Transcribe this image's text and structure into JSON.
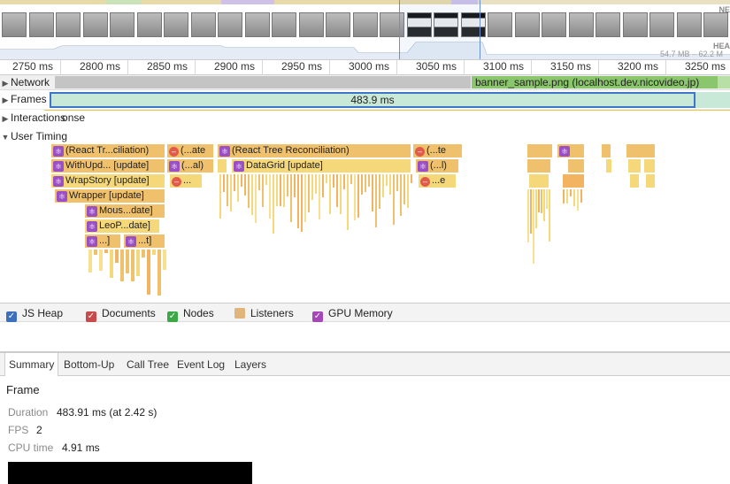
{
  "overview": {
    "net_label": "NE",
    "heap_label": "HEA",
    "heap_range": "54.7 MB – 62.2 M"
  },
  "ruler": {
    "ticks": [
      "2750 ms",
      "2800 ms",
      "2850 ms",
      "2900 ms",
      "2950 ms",
      "3000 ms",
      "3050 ms",
      "3100 ms",
      "3150 ms",
      "3200 ms",
      "3250 ms"
    ]
  },
  "tracks": {
    "network": "Network",
    "network_request": "banner_sample.png (localhost.dev.nicovideo.jp)",
    "frames": "Frames",
    "frame_duration": "483.9 ms",
    "interactions": "Interactions",
    "interactions_tail": "onse",
    "user_timing": "User Timing"
  },
  "user_timing": {
    "r1a": "(React Tr...ciliation)",
    "r1b": "(...ate",
    "r1c": "(React Tree Reconciliation)",
    "r1d": "(...te",
    "r2a": "WithUpd... [update]",
    "r2b": "(...al)",
    "r2c": "DataGrid [update]",
    "r2d": "(...l)",
    "r3a": "WrapStory [update]",
    "r3b": "...",
    "r3c": "...e",
    "r4a": "Wrapper [update]",
    "r5a": "Mous...date]",
    "r6a": "LeoP...date]",
    "r7a": "...]",
    "r7b": "...t]"
  },
  "legend": {
    "items": [
      {
        "label": "JS Heap",
        "color": "#3d6fbf",
        "checked": true
      },
      {
        "label": "Documents",
        "color": "#c94a4a",
        "checked": true
      },
      {
        "label": "Nodes",
        "color": "#3aa845",
        "checked": true
      },
      {
        "label": "Listeners",
        "color": "#e0b47a",
        "checked": false
      },
      {
        "label": "GPU Memory",
        "color": "#a646b8",
        "checked": true
      }
    ]
  },
  "tabs": [
    "Summary",
    "Bottom-Up",
    "Call Tree",
    "Event Log",
    "Layers"
  ],
  "summary": {
    "title": "Frame",
    "duration_label": "Duration",
    "duration_value": "483.91 ms (at 2.42 s)",
    "fps_label": "FPS",
    "fps_value": "2",
    "cpu_label": "CPU time",
    "cpu_value": "4.91 ms"
  },
  "colors": {
    "selection_border": "#3d75c9",
    "frame_fill": "#c8e8d8",
    "network_fill": "#8ac66b",
    "scripting": "#f0c16c",
    "react_icon": "#9b4fc4"
  }
}
